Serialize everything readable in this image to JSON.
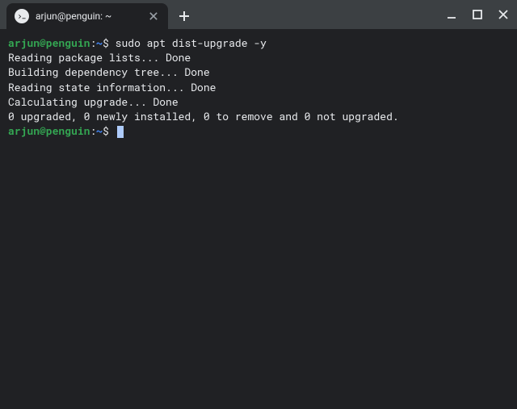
{
  "titlebar": {
    "tab_title": "arjun@penguin: ~"
  },
  "terminal": {
    "prompt1": {
      "user_host": "arjun@penguin",
      "colon": ":",
      "path": "~",
      "dollar": "$",
      "command": "sudo apt dist-upgrade -y"
    },
    "output": [
      "Reading package lists... Done",
      "Building dependency tree... Done",
      "Reading state information... Done",
      "Calculating upgrade... Done",
      "0 upgraded, 0 newly installed, 0 to remove and 0 not upgraded."
    ],
    "prompt2": {
      "user_host": "arjun@penguin",
      "colon": ":",
      "path": "~",
      "dollar": "$"
    }
  }
}
